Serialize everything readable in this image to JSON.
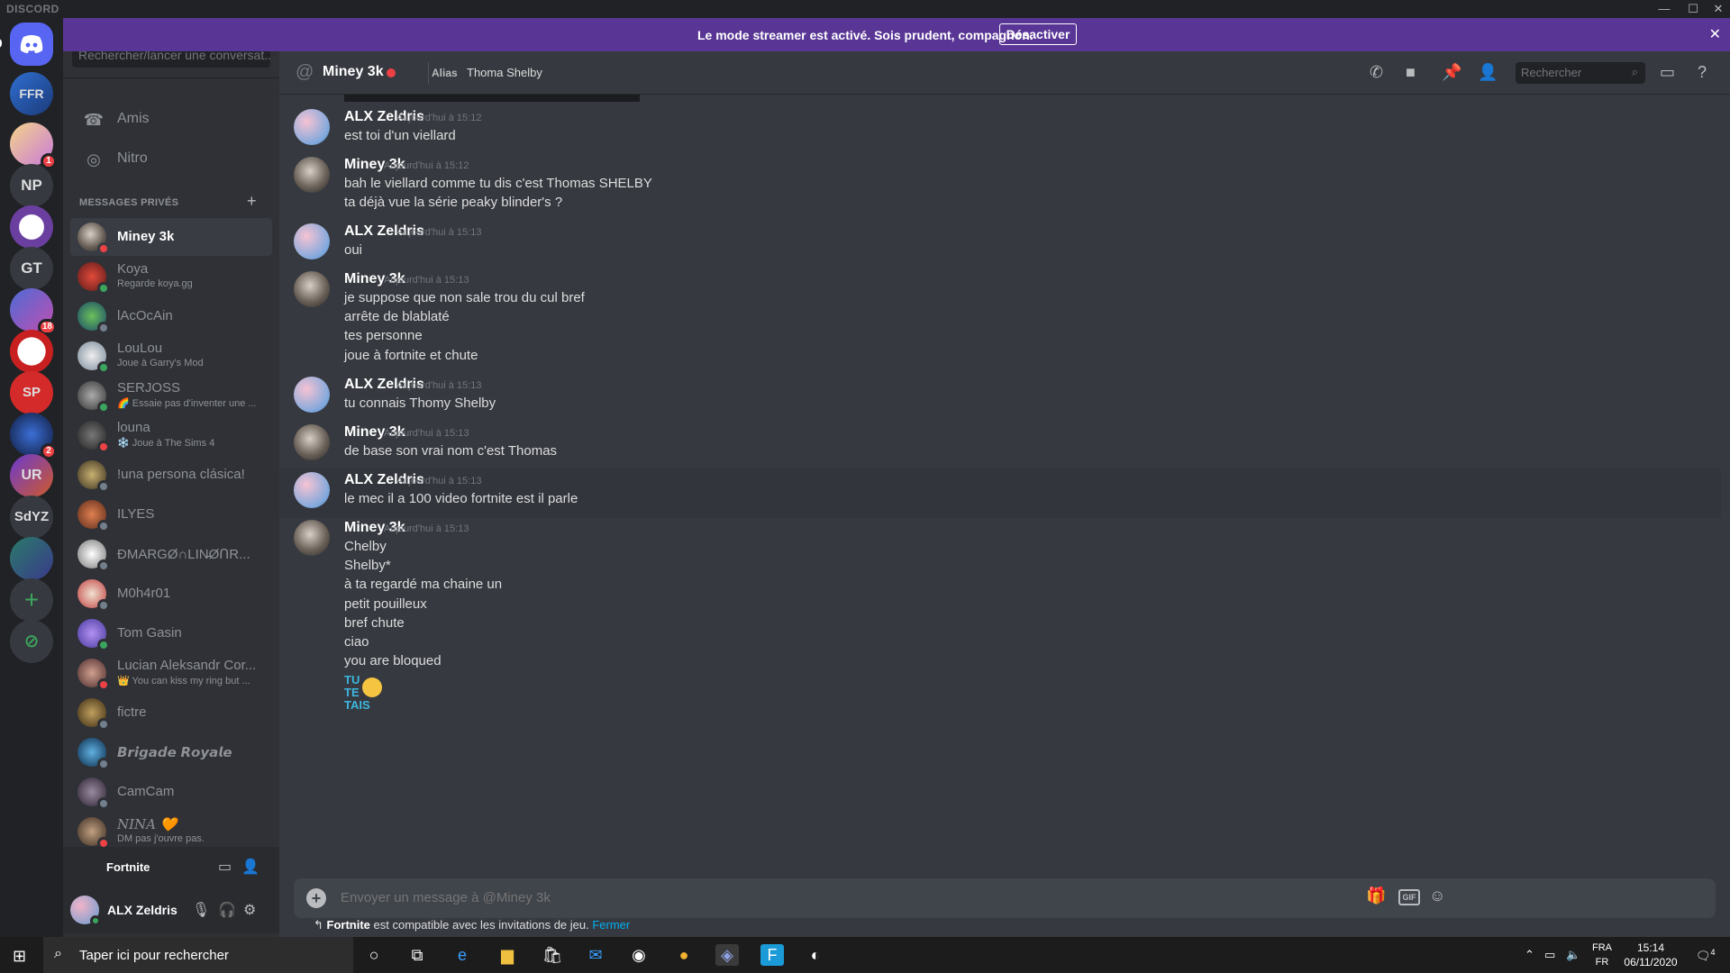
{
  "titlebar": {
    "brand": "DISCORD",
    "minimize": "—",
    "maximize": "☐",
    "close": "✕"
  },
  "streamer_banner": {
    "text": "Le mode streamer est activé. Sois prudent, compagnon.",
    "button": "Désactiver",
    "close": "✕"
  },
  "servers": [
    {
      "label": "FFR"
    },
    {
      "label": "",
      "badge": "1"
    },
    {
      "label": "NP"
    },
    {
      "label": ""
    },
    {
      "label": "GT"
    },
    {
      "label": "",
      "badge": "18"
    },
    {
      "label": ""
    },
    {
      "label": "SP"
    },
    {
      "label": "",
      "badge": "2"
    },
    {
      "label": "UR"
    },
    {
      "label": "SdYZ"
    },
    {
      "label": ""
    }
  ],
  "sidebar": {
    "search_placeholder": "Rechercher/lancer une conversat...",
    "nav": [
      {
        "label": "Amis"
      },
      {
        "label": "Nitro"
      }
    ],
    "dm_header": "MESSAGES PRIVÉS",
    "dm_add": "+",
    "dms": [
      {
        "name": "Miney 3k",
        "sub": ""
      },
      {
        "name": "Koya",
        "sub": "Regarde koya.gg"
      },
      {
        "name": "lAcOcAin",
        "sub": ""
      },
      {
        "name": "LouLou",
        "sub": "Joue à Garry's Mod"
      },
      {
        "name": "SERJOSS",
        "sub": "🌈 Essaie pas d'inventer une ..."
      },
      {
        "name": "louna",
        "sub": "❄️ Joue à The Sims 4"
      },
      {
        "name": "!una persona clásica!",
        "sub": ""
      },
      {
        "name": "ILYES",
        "sub": ""
      },
      {
        "name": "ÐMARGØ∩LIN̵ØՈR...",
        "sub": ""
      },
      {
        "name": "M0h4r01",
        "sub": ""
      },
      {
        "name": "Tom Gasin",
        "sub": ""
      },
      {
        "name": "Lucian Aleksandr Cor...",
        "sub": "👑 You can kiss my ring but ..."
      },
      {
        "name": "fictre",
        "sub": ""
      },
      {
        "name": "𝘽𝙧𝙞𝙜𝙖𝙙𝙚 𝙍𝙤𝙮𝙖𝙡𝙚",
        "sub": ""
      },
      {
        "name": "CamCam",
        "sub": ""
      },
      {
        "name": "NINA 🧡",
        "sub": "DM pas j'ouvre pas."
      }
    ],
    "game_activity": "Fortnite",
    "user": {
      "name": "ALX Zeldris"
    }
  },
  "chat_header": {
    "at": "@",
    "title": "Miney 3k",
    "alias_label": "Alias",
    "alias_value": "Thoma Shelby",
    "search_placeholder": "Rechercher"
  },
  "messages": [
    {
      "author": "ALX Zeldris",
      "time": "Aujourd'hui à 15:12",
      "lines": [
        "est toi d'un viellard"
      ]
    },
    {
      "author": "Miney 3k",
      "time": "Aujourd'hui à 15:12",
      "lines": [
        "bah le viellard comme tu dis c'est Thomas SHELBY",
        "ta déjà vue la série peaky blinder's ?"
      ]
    },
    {
      "author": "ALX Zeldris",
      "time": "Aujourd'hui à 15:13",
      "lines": [
        "oui"
      ]
    },
    {
      "author": "Miney 3k",
      "time": "Aujourd'hui à 15:13",
      "lines": [
        "je suppose que non sale trou du cul bref",
        "arrête de blablaté",
        "tes personne",
        "joue à fortnite et chute"
      ]
    },
    {
      "author": "ALX Zeldris",
      "time": "Aujourd'hui à 15:13",
      "lines": [
        "tu connais Thomy Shelby"
      ]
    },
    {
      "author": "Miney 3k",
      "time": "Aujourd'hui à 15:13",
      "lines": [
        "de base son vrai nom c'est Thomas"
      ]
    },
    {
      "author": "ALX Zeldris",
      "time": "Aujourd'hui à 15:13",
      "lines": [
        "le mec il a 100 video fortnite est il parle"
      ]
    },
    {
      "author": "Miney 3k",
      "time": "Aujourd'hui à 15:13",
      "lines": [
        "Chelby",
        "Shelby*",
        "à ta regardé ma chaine un",
        "petit pouilleux",
        "bref chute",
        "ciao",
        "you are bloqued"
      ]
    }
  ],
  "emoji_text": [
    "TU",
    "TE",
    "TAIS"
  ],
  "composer": {
    "placeholder": "Envoyer un message à @Miney 3k",
    "gif": "GIF"
  },
  "invite_notice": {
    "game": "Fortnite",
    "text": " est compatible avec les invitations de jeu. ",
    "link": "Fermer",
    "arrow": "↰"
  },
  "taskbar": {
    "search_placeholder": "Taper ici pour rechercher",
    "lang_1": "FRA",
    "lang_2": "FR",
    "time": "15:14",
    "date": "06/11/2020",
    "notif_count": "4"
  },
  "colors": {
    "blurple": "#5865f2",
    "streamer": "#593695",
    "online": "#3ba55d",
    "dnd": "#ed4245",
    "idle": "#747f8d"
  }
}
